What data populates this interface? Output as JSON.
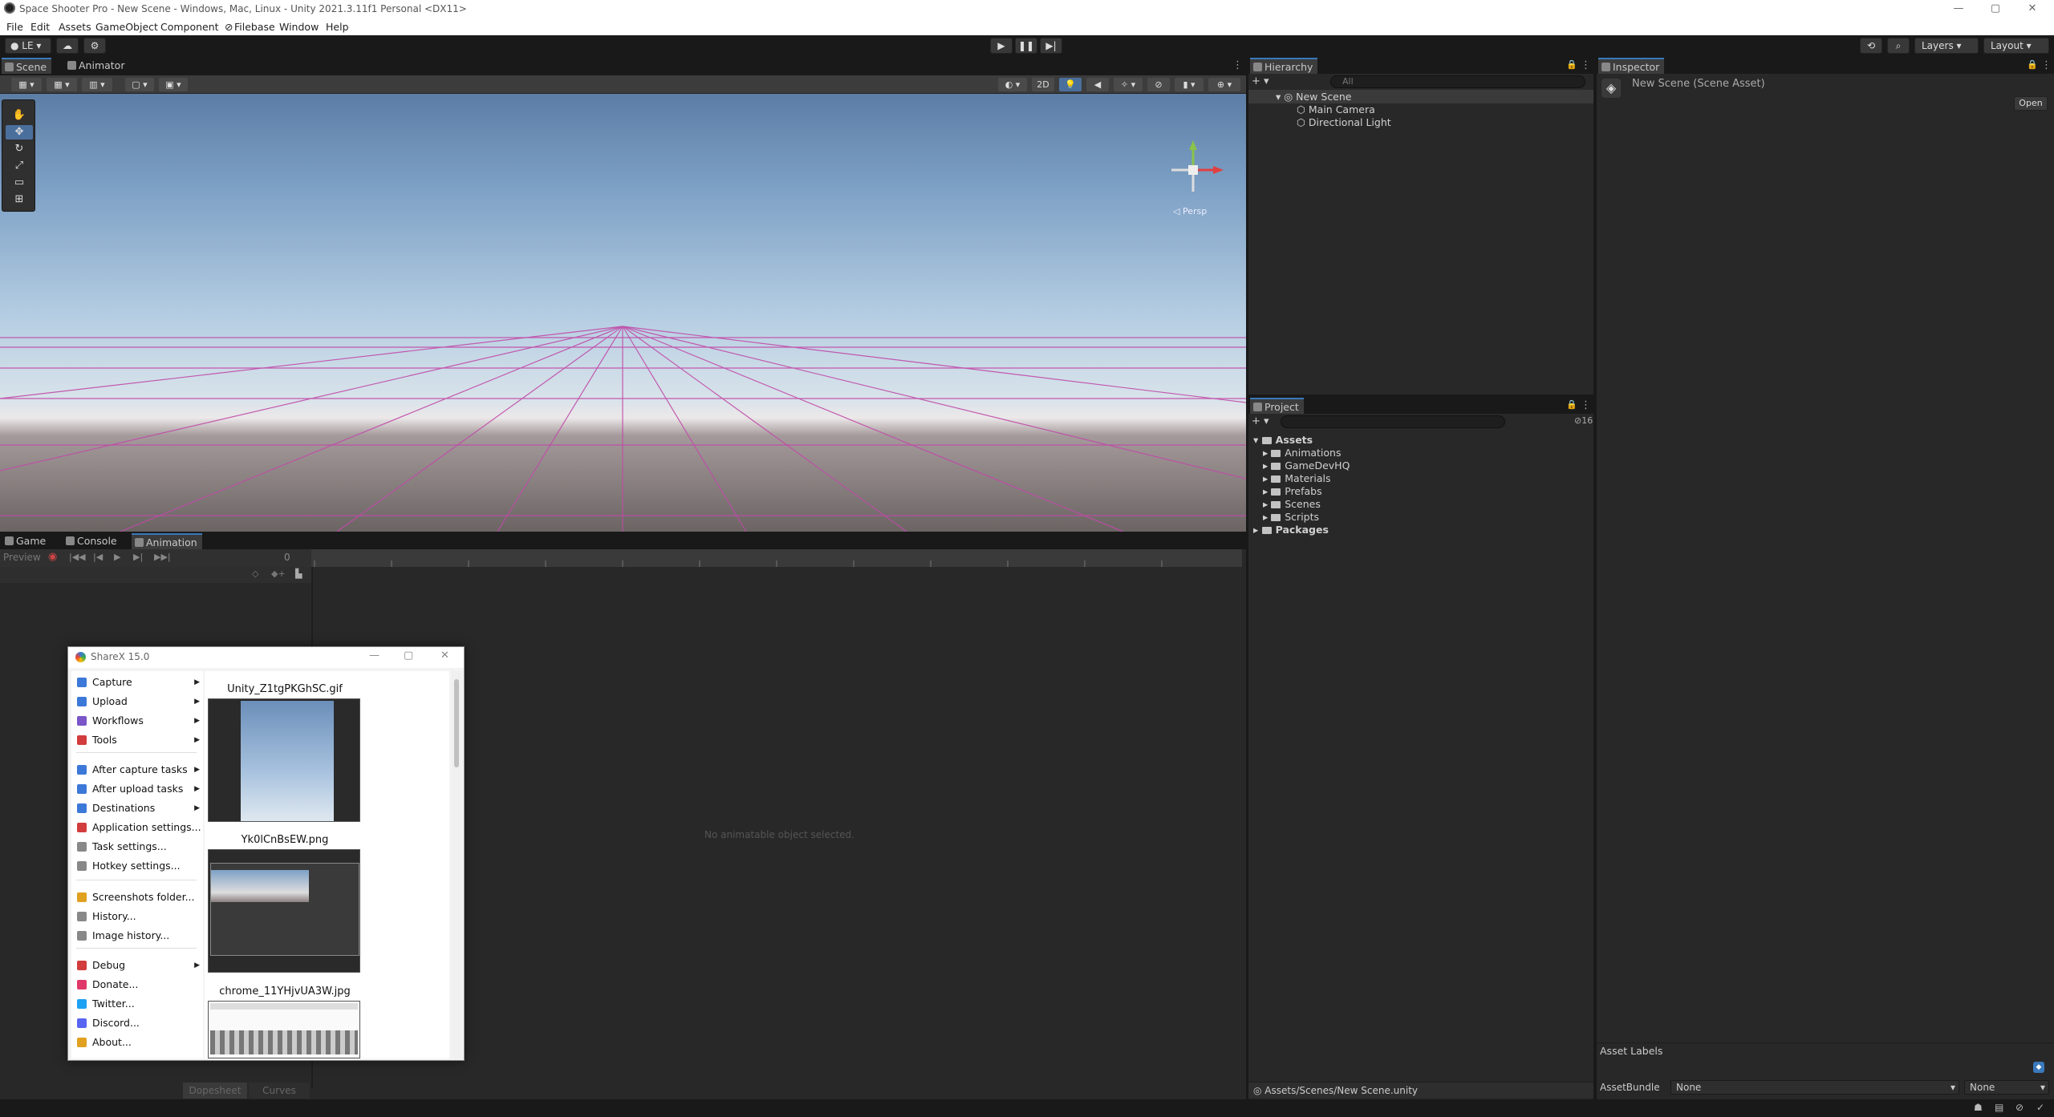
{
  "window": {
    "title": "Space Shooter Pro - New Scene - Windows, Mac, Linux - Unity 2021.3.11f1 Personal <DX11>",
    "controls": [
      "—",
      "▢",
      "✕"
    ]
  },
  "menubar": [
    "File",
    "Edit",
    "Assets",
    "GameObject",
    "Component",
    "Filebase",
    "Window",
    "Help"
  ],
  "toolbar": {
    "account": "LE",
    "layers": "Layers",
    "layout": "Layout"
  },
  "scene_panel": {
    "tabs": [
      "Scene",
      "Animator"
    ],
    "toggle_2d": "2D",
    "persp_label": "◁ Persp"
  },
  "hierarchy": {
    "tab": "Hierarchy",
    "search_placeholder": "All",
    "scene": "New Scene",
    "items": [
      "Main Camera",
      "Directional Light"
    ]
  },
  "inspector": {
    "tab": "Inspector",
    "asset_title": "New Scene (Scene Asset)",
    "open_button": "Open",
    "asset_labels": "Asset Labels",
    "assetbundle_label": "AssetBundle",
    "assetbundle_value": "None",
    "variant_value": "None"
  },
  "project": {
    "tab": "Project",
    "count": "16",
    "root": "Assets",
    "folders": [
      "Animations",
      "GameDevHQ",
      "Materials",
      "Prefabs",
      "Scenes",
      "Scripts"
    ],
    "packages": "Packages",
    "path": "Assets/Scenes/New Scene.unity"
  },
  "bottom_panel": {
    "tabs": [
      "Game",
      "Console",
      "Animation"
    ],
    "preview": "Preview",
    "frame": "0",
    "empty_message": "No animatable object selected.",
    "footer_tabs": [
      "Dopesheet",
      "Curves"
    ]
  },
  "sharex": {
    "title": "ShareX 15.0",
    "menu": [
      {
        "label": "Capture",
        "submenu": true,
        "color": "#3c78d8"
      },
      {
        "label": "Upload",
        "submenu": true,
        "color": "#3c78d8"
      },
      {
        "label": "Workflows",
        "submenu": true,
        "color": "#7a56c8"
      },
      {
        "label": "Tools",
        "submenu": true,
        "color": "#d23c3c"
      },
      {
        "label": "After capture tasks",
        "submenu": true,
        "color": "#3c78d8"
      },
      {
        "label": "After upload tasks",
        "submenu": true,
        "color": "#3c78d8"
      },
      {
        "label": "Destinations",
        "submenu": true,
        "color": "#3c78d8"
      },
      {
        "label": "Application settings...",
        "submenu": false,
        "color": "#d23c3c"
      },
      {
        "label": "Task settings...",
        "submenu": false,
        "color": "#888888"
      },
      {
        "label": "Hotkey settings...",
        "submenu": false,
        "color": "#888888"
      },
      {
        "label": "Screenshots folder...",
        "submenu": false,
        "color": "#e0a020"
      },
      {
        "label": "History...",
        "submenu": false,
        "color": "#888888"
      },
      {
        "label": "Image history...",
        "submenu": false,
        "color": "#888888"
      },
      {
        "label": "Debug",
        "submenu": true,
        "color": "#d23c3c"
      },
      {
        "label": "Donate...",
        "submenu": false,
        "color": "#e0386a"
      },
      {
        "label": "Twitter...",
        "submenu": false,
        "color": "#1da1f2"
      },
      {
        "label": "Discord...",
        "submenu": false,
        "color": "#5865f2"
      },
      {
        "label": "About...",
        "submenu": false,
        "color": "#e0a020"
      }
    ],
    "gallery": [
      "Unity_Z1tgPKGhSC.gif",
      "Yk0lCnBsEW.png",
      "chrome_11YHjvUA3W.jpg"
    ]
  }
}
